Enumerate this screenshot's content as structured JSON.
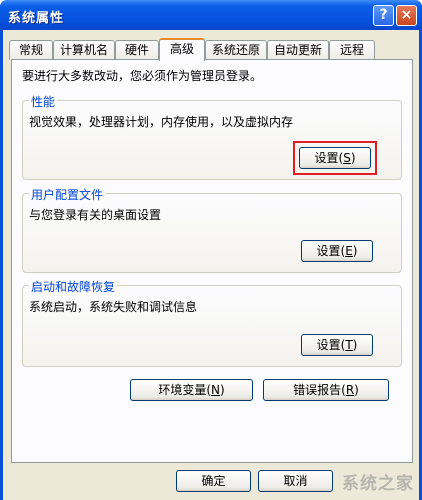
{
  "window": {
    "title": "系统属性",
    "help_label": "?",
    "close_label": "×"
  },
  "tabs": [
    {
      "label": "常规"
    },
    {
      "label": "计算机名"
    },
    {
      "label": "硬件"
    },
    {
      "label": "高级",
      "active": true
    },
    {
      "label": "系统还原"
    },
    {
      "label": "自动更新"
    },
    {
      "label": "远程"
    }
  ],
  "intro_text": "要进行大多数改动，您必须作为管理员登录。",
  "performance": {
    "title": "性能",
    "description": "视觉效果，处理器计划，内存使用，以及虚拟内存",
    "button_label": "设置",
    "button_key": "S"
  },
  "user_profiles": {
    "title": "用户配置文件",
    "description": "与您登录有关的桌面设置",
    "button_label": "设置",
    "button_key": "E"
  },
  "startup_recovery": {
    "title": "启动和故障恢复",
    "description": "系统启动，系统失败和调试信息",
    "button_label": "设置",
    "button_key": "T"
  },
  "env_button": {
    "label": "环境变量",
    "key": "N"
  },
  "error_button": {
    "label": "错误报告",
    "key": "R"
  },
  "ok_button": {
    "label": "确定"
  },
  "cancel_button": {
    "label": "取消"
  },
  "highlight_color": "#e02020",
  "watermark": "系统之家"
}
